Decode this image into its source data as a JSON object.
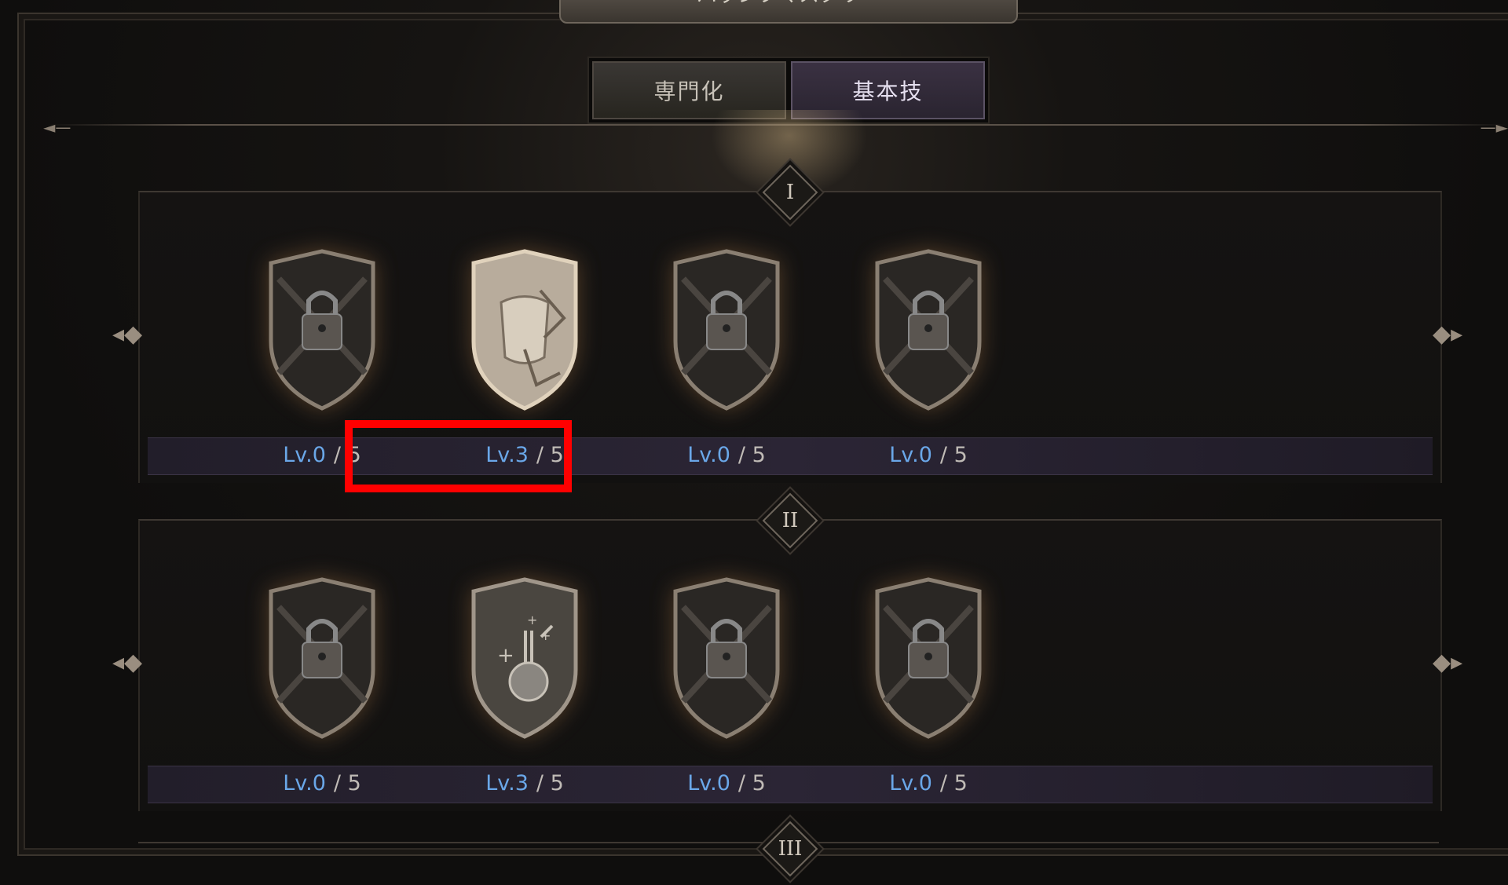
{
  "window": {
    "title": "パッシブマスタリー"
  },
  "tabs": [
    {
      "label": "専門化",
      "active": false
    },
    {
      "label": "基本技",
      "active": true
    }
  ],
  "tiers": [
    {
      "numeral": "I",
      "skills": [
        {
          "icon": "locked-padlock-icon",
          "level": "Lv.0",
          "max": "/ 5"
        },
        {
          "icon": "armor-upgrade-icon",
          "level": "Lv.3",
          "max": "/ 5"
        },
        {
          "icon": "locked-padlock-icon",
          "level": "Lv.0",
          "max": "/ 5"
        },
        {
          "icon": "locked-padlock-icon",
          "level": "Lv.0",
          "max": "/ 5"
        }
      ]
    },
    {
      "numeral": "II",
      "skills": [
        {
          "icon": "locked-padlock-icon",
          "level": "Lv.0",
          "max": "/ 5"
        },
        {
          "icon": "potion-flask-icon",
          "level": "Lv.3",
          "max": "/ 5"
        },
        {
          "icon": "locked-padlock-icon",
          "level": "Lv.0",
          "max": "/ 5"
        },
        {
          "icon": "locked-padlock-icon",
          "level": "Lv.0",
          "max": "/ 5"
        }
      ]
    },
    {
      "numeral": "III"
    }
  ],
  "colors": {
    "level_blue": "#6aa7e8",
    "highlight": "#ff0000",
    "active_tab": "#3a3142"
  }
}
